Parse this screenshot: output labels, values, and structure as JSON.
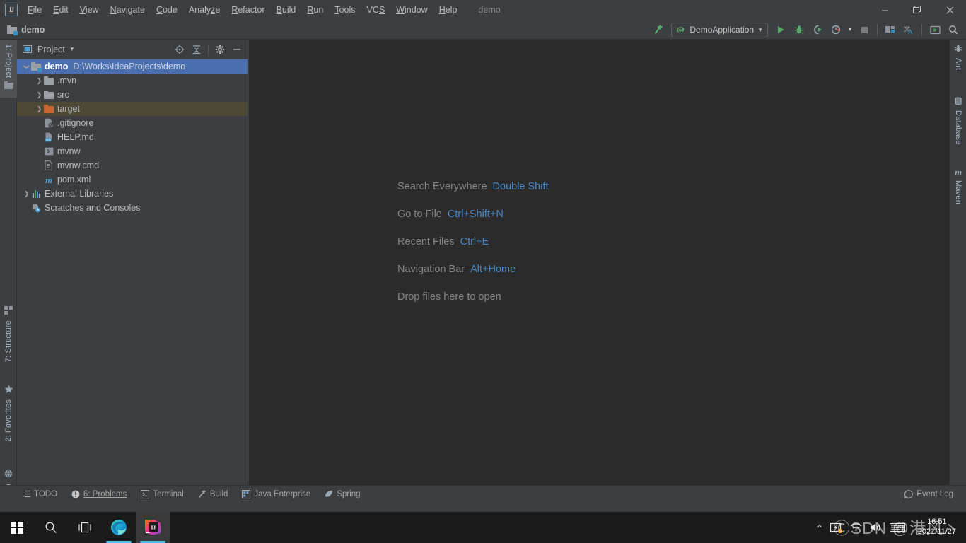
{
  "window": {
    "title": "demo",
    "controls": {
      "minimize": "—",
      "maximize": "❐",
      "close": "✕"
    }
  },
  "menubar": {
    "items": [
      {
        "label": "File",
        "mnemonic": "F"
      },
      {
        "label": "Edit",
        "mnemonic": "E"
      },
      {
        "label": "View",
        "mnemonic": "V"
      },
      {
        "label": "Navigate",
        "mnemonic": "N"
      },
      {
        "label": "Code",
        "mnemonic": "C"
      },
      {
        "label": "Analyze",
        "mnemonic": "z"
      },
      {
        "label": "Refactor",
        "mnemonic": "R"
      },
      {
        "label": "Build",
        "mnemonic": "B"
      },
      {
        "label": "Run",
        "mnemonic": "R"
      },
      {
        "label": "Tools",
        "mnemonic": "T"
      },
      {
        "label": "VCS",
        "mnemonic": "S"
      },
      {
        "label": "Window",
        "mnemonic": "W"
      },
      {
        "label": "Help",
        "mnemonic": "H"
      }
    ]
  },
  "navbar": {
    "breadcrumb": "demo",
    "run_configuration": "DemoApplication",
    "buttons": [
      {
        "name": "build-hammer-icon",
        "title": "Build Project"
      },
      {
        "name": "run-icon",
        "title": "Run"
      },
      {
        "name": "debug-icon",
        "title": "Debug"
      },
      {
        "name": "run-with-coverage-icon",
        "title": "Run with Coverage"
      },
      {
        "name": "profiler-icon",
        "title": "Profiler"
      },
      {
        "name": "stop-icon",
        "title": "Stop"
      },
      {
        "name": "project-structure-icon",
        "title": "Project Structure"
      },
      {
        "name": "translate-icon",
        "title": "Translate"
      },
      {
        "name": "updates-icon",
        "title": "Updates"
      },
      {
        "name": "search-icon",
        "title": "Search Everywhere"
      }
    ]
  },
  "project_panel": {
    "title": "Project",
    "actions": [
      {
        "name": "select-opened-file-icon"
      },
      {
        "name": "collapse-all-icon"
      },
      {
        "name": "gear-icon"
      },
      {
        "name": "hide-icon"
      }
    ],
    "tree": [
      {
        "label": "demo",
        "path": "D:\\Works\\IdeaProjects\\demo",
        "icon": "module-folder",
        "arrow": "expanded",
        "indent": 0,
        "state": "selected"
      },
      {
        "label": ".mvn",
        "path": "",
        "icon": "folder-gray",
        "arrow": "collapsed",
        "indent": 1,
        "state": ""
      },
      {
        "label": "src",
        "path": "",
        "icon": "folder-gray",
        "arrow": "collapsed",
        "indent": 1,
        "state": ""
      },
      {
        "label": "target",
        "path": "",
        "icon": "folder-orange",
        "arrow": "collapsed",
        "indent": 1,
        "state": "highlight"
      },
      {
        "label": ".gitignore",
        "path": "",
        "icon": "gitignore",
        "arrow": "none",
        "indent": 1,
        "state": ""
      },
      {
        "label": "HELP.md",
        "path": "",
        "icon": "markdown",
        "arrow": "none",
        "indent": 1,
        "state": ""
      },
      {
        "label": "mvnw",
        "path": "",
        "icon": "shell",
        "arrow": "none",
        "indent": 1,
        "state": ""
      },
      {
        "label": "mvnw.cmd",
        "path": "",
        "icon": "cmd",
        "arrow": "none",
        "indent": 1,
        "state": ""
      },
      {
        "label": "pom.xml",
        "path": "",
        "icon": "maven",
        "arrow": "none",
        "indent": 1,
        "state": ""
      },
      {
        "label": "External Libraries",
        "path": "",
        "icon": "libraries",
        "arrow": "collapsed",
        "indent": 0,
        "state": ""
      },
      {
        "label": "Scratches and Consoles",
        "path": "",
        "icon": "scratches",
        "arrow": "none",
        "indent": 0,
        "state": ""
      }
    ]
  },
  "left_tool_strip": [
    {
      "label": "1: Project",
      "icon": "project-icon",
      "active": true
    },
    {
      "label": "7: Structure",
      "icon": "structure-icon",
      "active": false
    },
    {
      "label": "2: Favorites",
      "icon": "star-icon",
      "active": false
    },
    {
      "label": "Web",
      "icon": "web-icon",
      "active": false
    }
  ],
  "right_tool_strip": [
    {
      "label": "Ant",
      "icon": "ant-icon"
    },
    {
      "label": "Database",
      "icon": "database-icon"
    },
    {
      "label": "Maven",
      "icon": "maven-icon"
    }
  ],
  "editor": {
    "hints": [
      {
        "action": "Search Everywhere",
        "shortcut": "Double Shift"
      },
      {
        "action": "Go to File",
        "shortcut": "Ctrl+Shift+N"
      },
      {
        "action": "Recent Files",
        "shortcut": "Ctrl+E"
      },
      {
        "action": "Navigation Bar",
        "shortcut": "Alt+Home"
      },
      {
        "action": "Drop files here to open",
        "shortcut": ""
      }
    ]
  },
  "statusbar": {
    "items": [
      {
        "label": "TODO",
        "icon": "todo-icon"
      },
      {
        "label": "6: Problems",
        "icon": "problems-icon"
      },
      {
        "label": "Terminal",
        "icon": "terminal-icon"
      },
      {
        "label": "Build",
        "icon": "build-icon"
      },
      {
        "label": "Java Enterprise",
        "icon": "java-enterprise-icon"
      },
      {
        "label": "Spring",
        "icon": "spring-icon"
      }
    ],
    "event_log": "Event Log"
  },
  "taskbar": {
    "items": [
      {
        "name": "start-button",
        "icon": "windows-logo"
      },
      {
        "name": "search-button",
        "icon": "search-icon"
      },
      {
        "name": "task-view-button",
        "icon": "task-view-icon"
      },
      {
        "name": "edge-button",
        "icon": "edge-icon",
        "running": true
      },
      {
        "name": "intellij-button",
        "icon": "intellij-icon",
        "running": true,
        "active": true
      }
    ],
    "tray": {
      "chevron": "∧",
      "icons": [
        "battery-icon",
        "wifi-icon",
        "volume-icon",
        "keyboard-icon",
        "ime-icon"
      ],
      "time": "16:51",
      "date": "2021/11/27"
    },
    "watermark": "ⒸSDN @港风丶"
  },
  "colors": {
    "panel_bg": "#3c3f41",
    "editor_bg": "#2b2b2b",
    "selection": "#4b6eaf",
    "highlight": "#4e4837",
    "accent_blue": "#4a88c7",
    "run_green": "#59a869",
    "taskbar_bg": "#1b1b1b"
  }
}
